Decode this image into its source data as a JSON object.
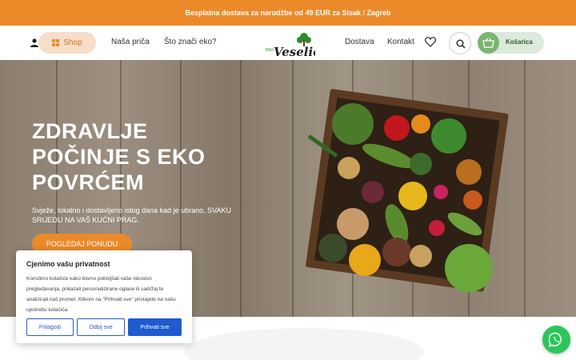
{
  "topbar": {
    "message": "Besplatna dostava za narudžbe od 49 EUR za Sisak / Zagreb"
  },
  "nav": {
    "shop_label": "Shop",
    "links": [
      "Naša priča",
      "Što znači eko?",
      "Dostava",
      "Kontakt"
    ],
    "cart_label": "Košarica"
  },
  "logo": {
    "small": "EKO",
    "name": "Veselić"
  },
  "hero": {
    "title": "ZDRAVLJE POČINJE S EKO POVRĆEM",
    "subtitle": "Svježe, lokalno i dostavljeno istog dana kad je ubrano, SVAKU SRIJEDU NA VAŠ KUĆNI PRAG.",
    "cta": "POGLEDAJ PONUDU"
  },
  "cookie": {
    "title": "Cjenimo vašu privatnost",
    "text": "Koristimo kolačiće kako bismo poboljšali vaše iskustvo pregledavanja, prikazali personalizirane oglase ili sadržaj te analizirali naš promet. Klikom na \"Prihvati sve\" pristajete na našu upotrebu kolačića.",
    "customize": "Prilagodi",
    "reject": "Odbij sve",
    "accept": "Prihvati sve"
  },
  "colors": {
    "accent": "#ec8a2a",
    "green": "#79b56f",
    "blue": "#1f5ad1",
    "whatsapp": "#2cc55b"
  },
  "icons": [
    "user-icon",
    "grid-icon",
    "heart-icon",
    "search-icon",
    "basket-icon",
    "whatsapp-icon"
  ]
}
